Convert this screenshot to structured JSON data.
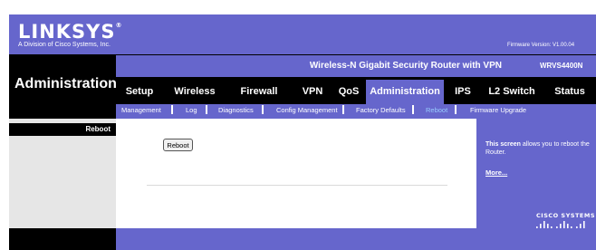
{
  "header": {
    "logo_text": "LINKSYS",
    "logo_mark": "®",
    "tagline": "A Division of Cisco Systems, Inc.",
    "firmware_version": "Firmware Version: V1.00.04"
  },
  "section": {
    "title": "Administration"
  },
  "product": {
    "name": "Wireless-N Gigabit Security Router with VPN",
    "model": "WRVS4400N"
  },
  "tabs": [
    {
      "label": "Setup",
      "active": false
    },
    {
      "label": "Wireless",
      "active": false
    },
    {
      "label": "Firewall",
      "active": false
    },
    {
      "label": "VPN",
      "active": false
    },
    {
      "label": "QoS",
      "active": false
    },
    {
      "label": "Administration",
      "active": true
    },
    {
      "label": "IPS",
      "active": false
    },
    {
      "label": "L2 Switch",
      "active": false
    },
    {
      "label": "Status",
      "active": false
    }
  ],
  "subtabs": [
    {
      "label": "Management",
      "active": false
    },
    {
      "label": "Log",
      "active": false
    },
    {
      "label": "Diagnostics",
      "active": false
    },
    {
      "label": "Config Management",
      "active": false
    },
    {
      "label": "Factory Defaults",
      "active": false
    },
    {
      "label": "Reboot",
      "active": true
    },
    {
      "label": "Firmware Upgrade",
      "active": false
    }
  ],
  "sidebar": {
    "label": "Reboot"
  },
  "main": {
    "reboot_button": "Reboot"
  },
  "help": {
    "lead": "This screen",
    "text": " allows you to reboot the Router.",
    "more_link": "More..."
  },
  "footer_logo": {
    "text": "CISCO SYSTEMS"
  },
  "colors": {
    "brand_purple": "#6666cc",
    "band_black": "#000000",
    "active_subtab": "#99ccff",
    "left_panel_gray": "#e6e6e6"
  }
}
